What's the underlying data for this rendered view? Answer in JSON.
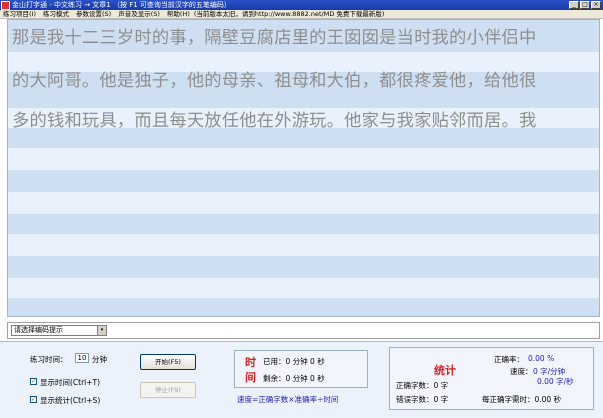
{
  "window": {
    "title": "金山打字通 - 中文练习 → 文章1 （按 F1 可查询当前汉字的五笔编码）",
    "controls": {
      "minimize": "_",
      "maximize": "□",
      "close": "×"
    }
  },
  "menu": {
    "items": [
      "练习项目(I)",
      "练习模式",
      "参数设置(S)",
      "声音及显示(S)",
      "帮助(H)"
    ],
    "link_text": "(当前版本太旧，请到http://www.8882.net/MD 免费下载最新版)"
  },
  "practice_text": {
    "lines": [
      "那是我十二三岁时的事，隔壁豆腐店里的王囡囡是当时我的小伴侣中",
      "的大阿哥。他是独子，他的母亲、祖母和大伯，都很疼爱他，给他很",
      "多的钱和玩具，而且每天放任他在外游玩。他家与我家贴邻而居。我"
    ]
  },
  "filter": {
    "selected": "请选择编码提示",
    "arrow": "▾"
  },
  "controls": {
    "practice_time_label": "练习时间：",
    "practice_time_value": "10",
    "practice_time_unit": "分钟",
    "show_time_label": "显示时间(Ctrl+T)",
    "show_stats_label": "显示统计(Ctrl+S)",
    "check_mark": "✓",
    "start_button": "开始(F5)",
    "stop_button": "停止(F9)"
  },
  "timer": {
    "char_1": "时",
    "char_2": "间",
    "elapsed": "已用：0 分钟 0 秒",
    "remaining": "剩余：0 分钟 0 秒",
    "speed_formula": "速度=正确字数×准确率÷时间"
  },
  "stats": {
    "title": "统计",
    "accuracy_label": "正确率：",
    "accuracy_value": "0.00 %",
    "speed_label": "速度：",
    "speed_value_1": "0 字/分钟",
    "speed_value_2": "0.00 字/秒",
    "correct_count": "正确字数：0 字",
    "error_count": "错误字数：0 字",
    "per_correct_time": "每正确字需时：0.00 秒"
  },
  "colors": {
    "band_dark": "#cfdff2",
    "band_light": "#e8f1fc",
    "title_bar": "#2a52c8",
    "highlight_red": "#d02020",
    "value_blue": "#2020c0"
  }
}
